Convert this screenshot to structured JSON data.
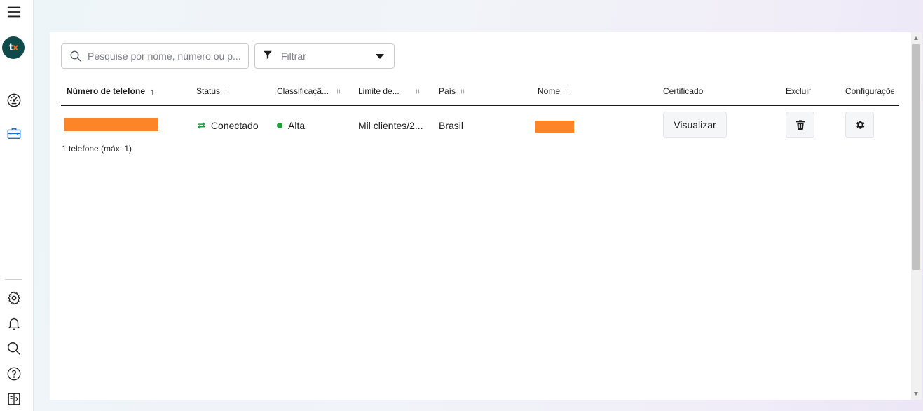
{
  "sidebar": {
    "logo_text_main": "t",
    "logo_text_accent": "x",
    "icons": [
      "menu-icon",
      "dashboard-icon",
      "briefcase-icon",
      "gear-icon",
      "bell-icon",
      "search-icon",
      "help-icon",
      "panel-toggle-icon"
    ]
  },
  "toolbar": {
    "search_placeholder": "Pesquise por nome, número ou p...",
    "filter_label": "Filtrar"
  },
  "table": {
    "columns": {
      "phone": "Número de telefone",
      "status": "Status",
      "rating": "Classificaçã...",
      "limit": "Limite de...",
      "country": "País",
      "name": "Nome",
      "certificate": "Certificado",
      "delete": "Excluir",
      "settings": "Configuraçõe"
    },
    "rows": [
      {
        "status": "Conectado",
        "rating": "Alta",
        "limit": "Mil clientes/2...",
        "country": "Brasil",
        "certificate_button": "Visualizar"
      }
    ],
    "footer_count": "1 telefone (máx: 1)"
  },
  "colors": {
    "accent_orange": "#fd8528",
    "status_green": "#1a9e3f",
    "logo_bg": "#0f4a4a"
  }
}
